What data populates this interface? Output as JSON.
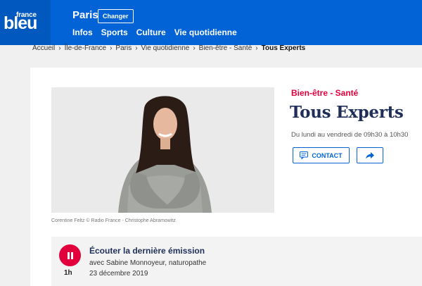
{
  "header": {
    "logo_small": "france",
    "logo_big": "bleu",
    "city": "Paris",
    "change_label": "Changer",
    "nav": [
      "Infos",
      "Sports",
      "Culture",
      "Vie quotidienne"
    ]
  },
  "breadcrumb": [
    "Accueil",
    "Île-de-France",
    "Paris",
    "Vie quotidienne",
    "Bien-être - Santé",
    "Tous Experts"
  ],
  "show": {
    "category": "Bien-être - Santé",
    "title": "Tous Experts",
    "schedule": "Du lundi au vendredi de 09h30 à 10h30",
    "contact_label": "CONTACT",
    "photo_caption": "Corentine Feltz © Radio France - Christophe Abramowitz"
  },
  "episode": {
    "title": "Écouter la dernière émission",
    "guest": "avec Sabine Monnoyeur, naturopathe",
    "date": "23 décembre 2019",
    "duration": "1h"
  },
  "colors": {
    "brand_blue": "#0163d6",
    "accent_red": "#e2003c",
    "title_navy": "#1f2f5a"
  }
}
